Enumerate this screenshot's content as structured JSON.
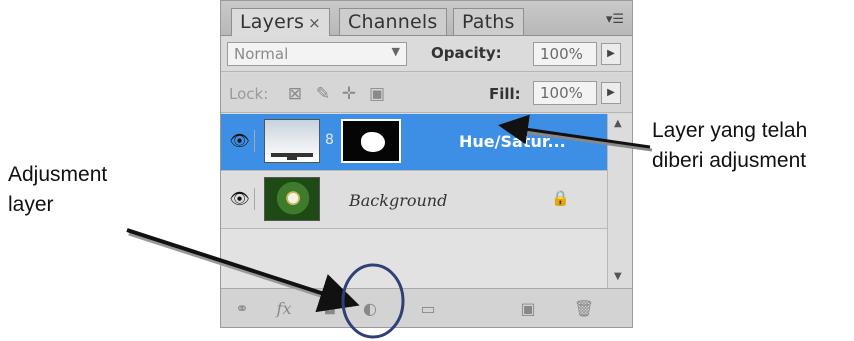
{
  "tabs": [
    {
      "label": "Layers",
      "close": "×",
      "active": true
    },
    {
      "label": "Channels",
      "active": false
    },
    {
      "label": "Paths",
      "active": false
    }
  ],
  "blend_mode": "Normal",
  "opacity": {
    "label": "Opacity:",
    "value": "100%"
  },
  "lock_label": "Lock:",
  "fill": {
    "label": "Fill:",
    "value": "100%"
  },
  "layers": [
    {
      "name": "Hue/Satur...",
      "selected": true,
      "type": "adjustment"
    },
    {
      "name": "Background",
      "selected": false,
      "type": "image",
      "locked": true
    }
  ],
  "footer_icons": [
    "link-layers-icon",
    "fx-icon",
    "add-mask-icon",
    "adjustment-layer-icon",
    "new-group-icon",
    "new-layer-icon",
    "trash-icon"
  ],
  "footer_fx_label": "fx",
  "annotations": {
    "left_line1": "Adjusment",
    "left_line2": "layer",
    "right_line1": "Layer yang telah",
    "right_line2": "diberi adjusment"
  },
  "colors": {
    "selection": "#3d8fe6",
    "circle": "#2f3f78"
  }
}
